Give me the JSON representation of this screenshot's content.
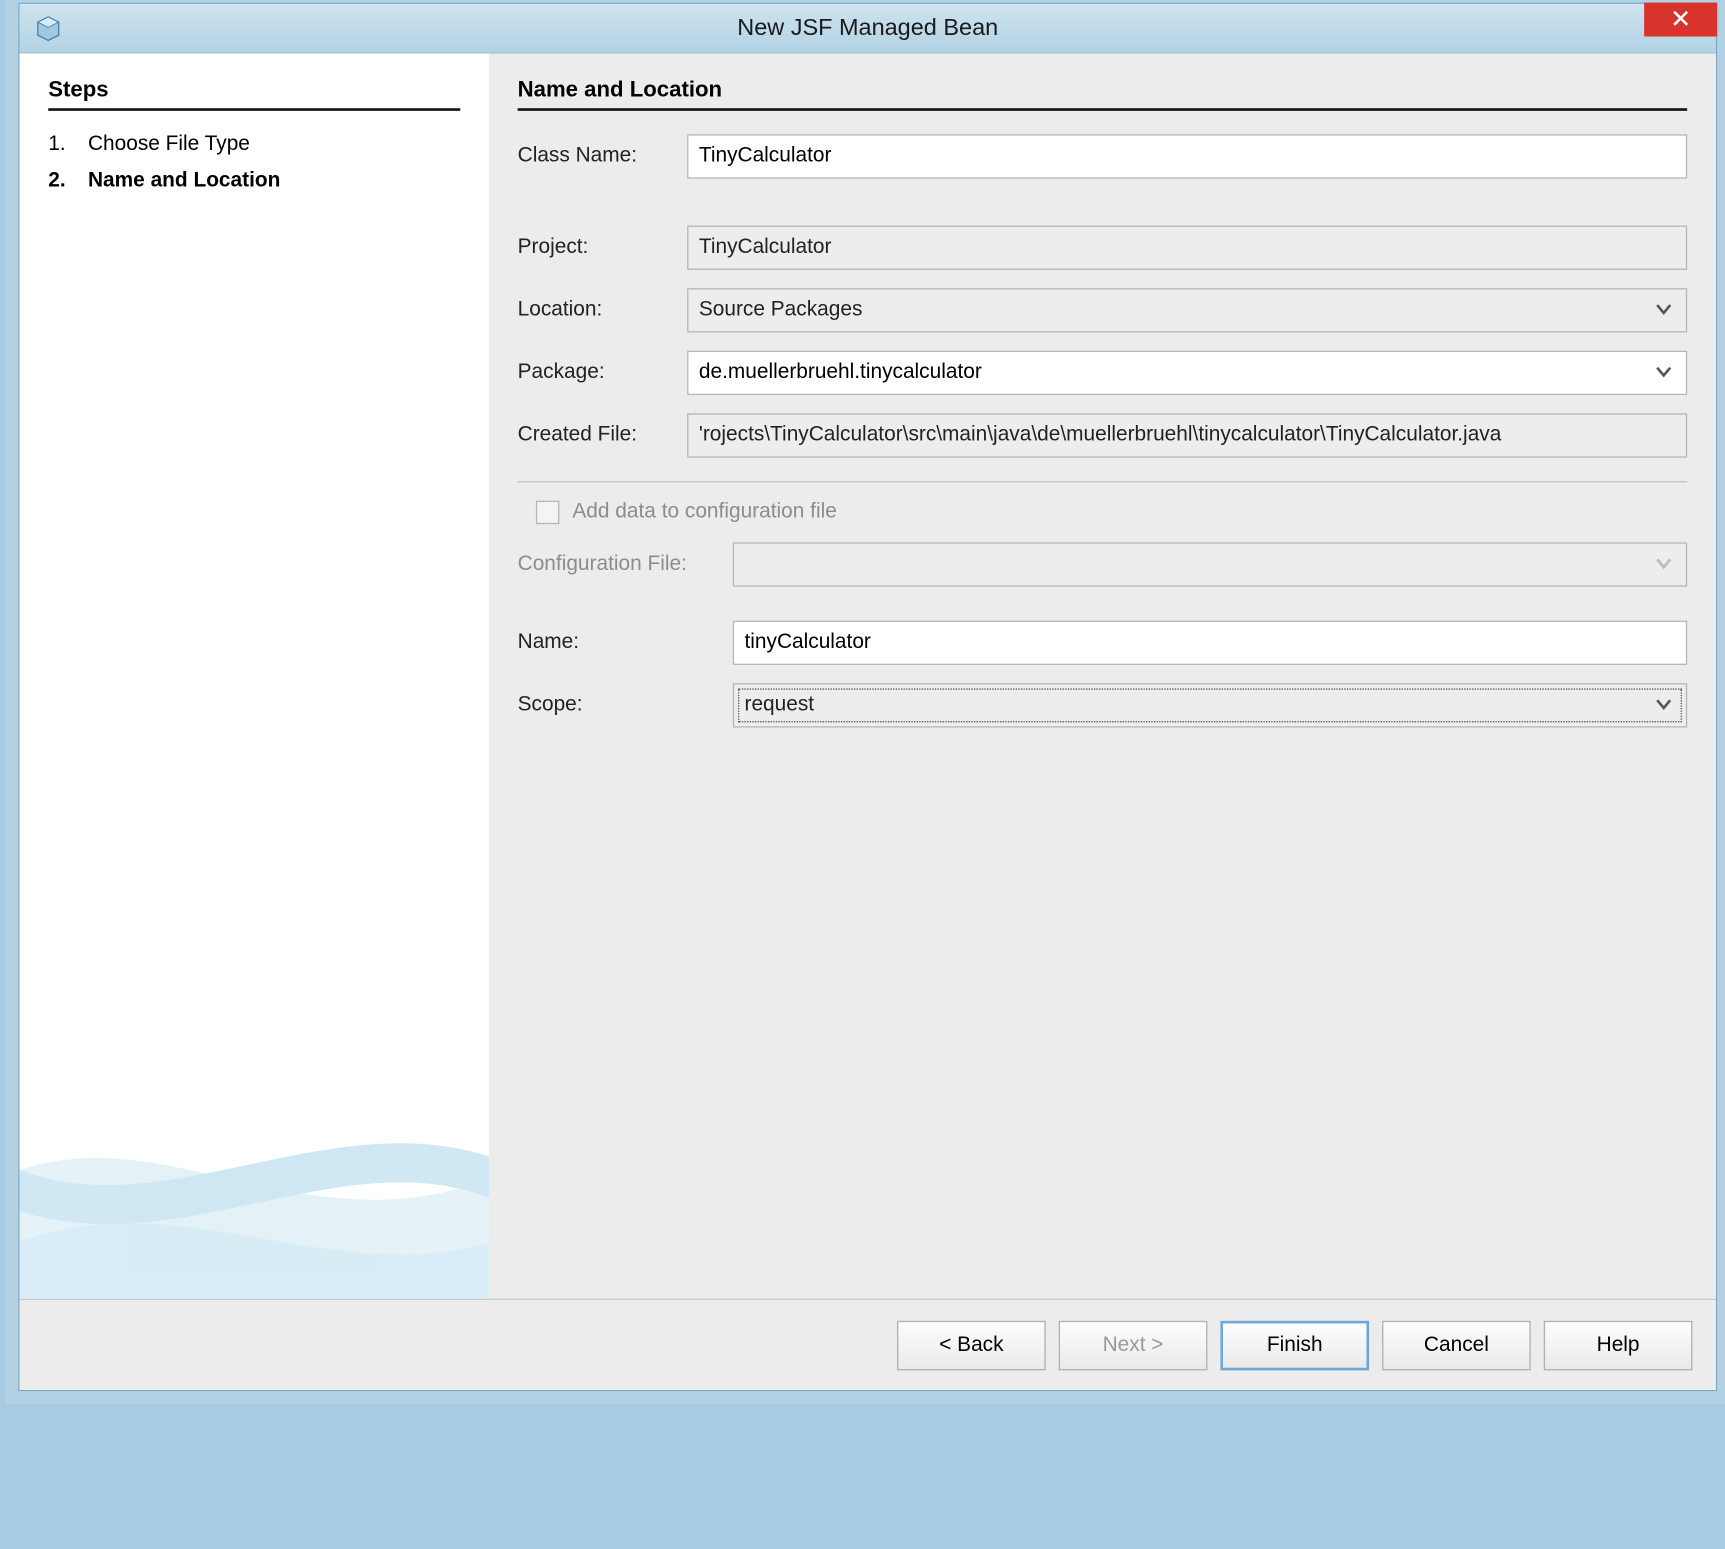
{
  "window": {
    "title": "New JSF Managed Bean"
  },
  "sidebar": {
    "heading": "Steps",
    "steps": [
      {
        "num": "1.",
        "label": "Choose File Type"
      },
      {
        "num": "2.",
        "label": "Name and Location"
      }
    ],
    "active_index": 1
  },
  "form": {
    "heading": "Name and Location",
    "class_name_label": "Class Name:",
    "class_name": "TinyCalculator",
    "project_label": "Project:",
    "project": "TinyCalculator",
    "location_label": "Location:",
    "location": "Source Packages",
    "package_label": "Package:",
    "package": "de.muellerbruehl.tinycalculator",
    "created_file_label": "Created File:",
    "created_file": "'rojects\\TinyCalculator\\src\\main\\java\\de\\muellerbruehl\\tinycalculator\\TinyCalculator.java",
    "add_config_label": "Add data to configuration file",
    "add_config_checked": false,
    "config_file_label": "Configuration File:",
    "config_file": "",
    "name_label": "Name:",
    "name": "tinyCalculator",
    "scope_label": "Scope:",
    "scope": "request"
  },
  "buttons": {
    "back": "< Back",
    "next": "Next >",
    "finish": "Finish",
    "cancel": "Cancel",
    "help": "Help"
  }
}
